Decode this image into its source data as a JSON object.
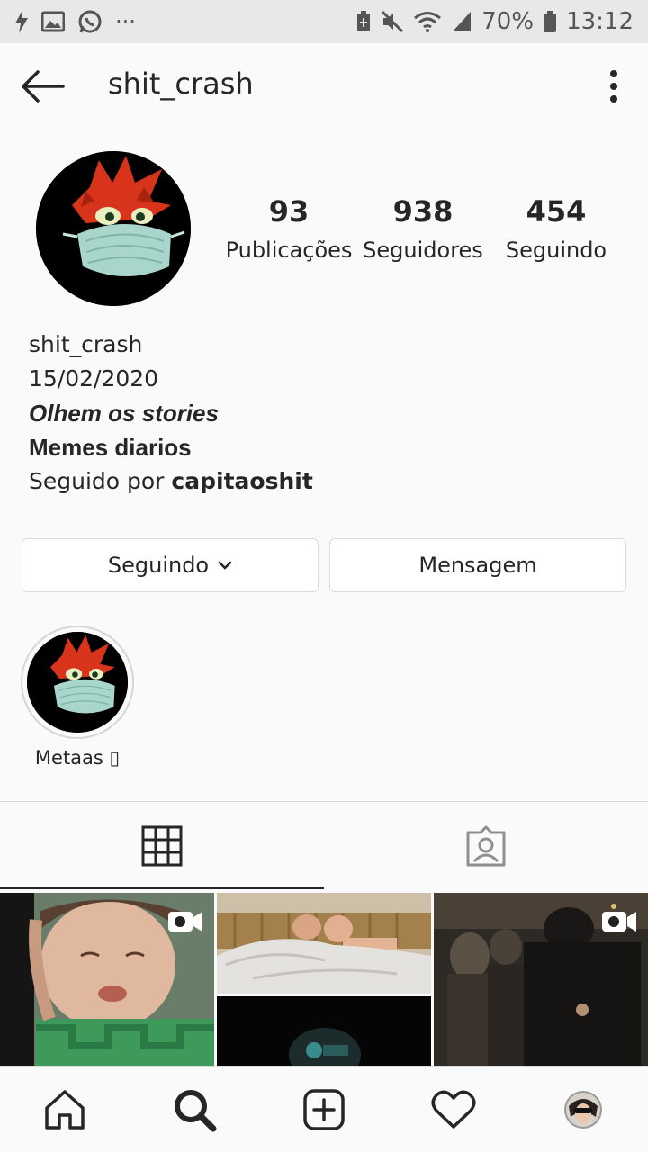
{
  "status_bar": {
    "battery": "70%",
    "time": "13:12"
  },
  "header": {
    "username": "shit_crash"
  },
  "stats": [
    {
      "count": "93",
      "label": "Publicações"
    },
    {
      "count": "938",
      "label": "Seguidores"
    },
    {
      "count": "454",
      "label": "Seguindo"
    }
  ],
  "bio": {
    "name": "shit_crash",
    "date": "15/02/2020",
    "line1": "Olhem os stories",
    "line2": "Memes diarios",
    "followed_by_prefix": "Seguido por ",
    "followed_by_user": "capitaoshit"
  },
  "buttons": {
    "following": "Seguindo",
    "message": "Mensagem"
  },
  "highlights": [
    {
      "label": "Metaas ▯"
    }
  ],
  "tabs": [
    {
      "icon": "grid-icon"
    },
    {
      "icon": "tagged-icon"
    }
  ],
  "nav": [
    {
      "icon": "home-icon"
    },
    {
      "icon": "search-icon"
    },
    {
      "icon": "new-post-icon"
    },
    {
      "icon": "activity-icon"
    },
    {
      "icon": "profile-icon"
    }
  ]
}
